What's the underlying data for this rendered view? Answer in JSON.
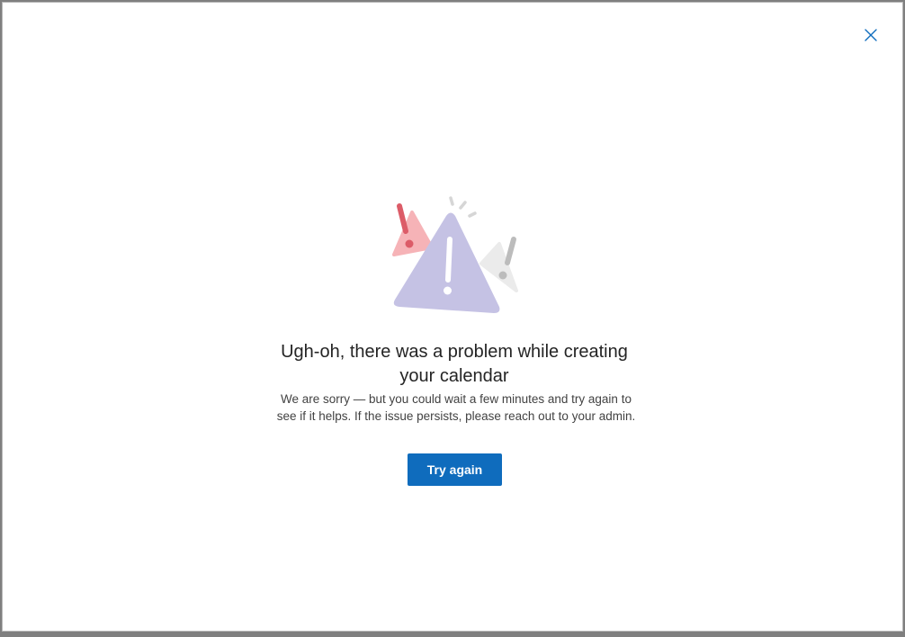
{
  "dialog": {
    "close_icon": "close-icon",
    "illustration_icon": "warning-triangles-icon",
    "title": "Ugh-oh, there was a problem while creating your calendar",
    "message": "We are sorry — but you could wait a few minutes and try again to see if it helps. If the issue persists, please reach out to your admin.",
    "try_again_label": "Try again"
  },
  "colors": {
    "accent": "#0f6cbd",
    "background_overlay": "#7f7f7f",
    "triangle_main": "#c5c2e4",
    "triangle_left": "#f4a8ac",
    "exclaim_left": "#dc5c68",
    "triangle_right": "#e6e6e6",
    "exclaim_right": "#b9b9b9"
  }
}
